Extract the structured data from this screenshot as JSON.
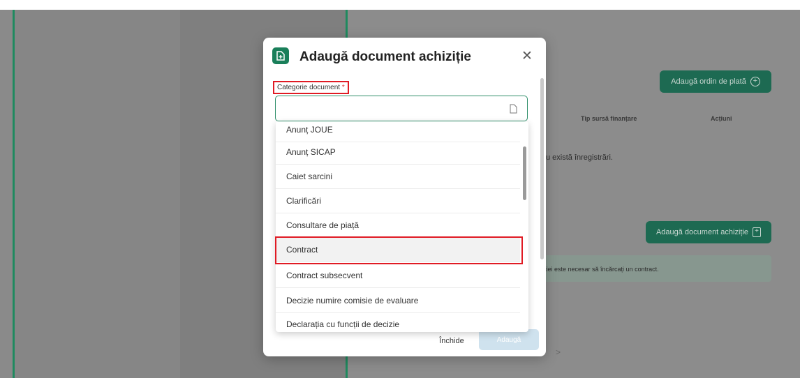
{
  "background": {
    "payment_button": "Adaugă ordin de plată",
    "col_funding": "Tip sursă finanțare",
    "col_actions": "Acțiuni",
    "no_records": "u există înregistrări.",
    "add_doc_button": "Adaugă document achiziție",
    "contract_notice": "ției este necesar să încărcați un contract."
  },
  "modal": {
    "title": "Adaugă document achiziție",
    "field_label": "Categorie document",
    "required_mark": "*",
    "input_value": "",
    "close_button": "Închide",
    "add_button": "Adaugă"
  },
  "dropdown": {
    "options": [
      "Anunț JOUE",
      "Anunț SICAP",
      "Caiet sarcini",
      "Clarificări",
      "Consultare de piață",
      "Contract",
      "Contract subsecvent",
      "Decizie numire comisie de evaluare",
      "Declarația cu funcții de decizie"
    ],
    "highlighted": "Contract"
  },
  "colors": {
    "accent": "#1a7f5a",
    "highlight_outline": "#e01b24"
  }
}
